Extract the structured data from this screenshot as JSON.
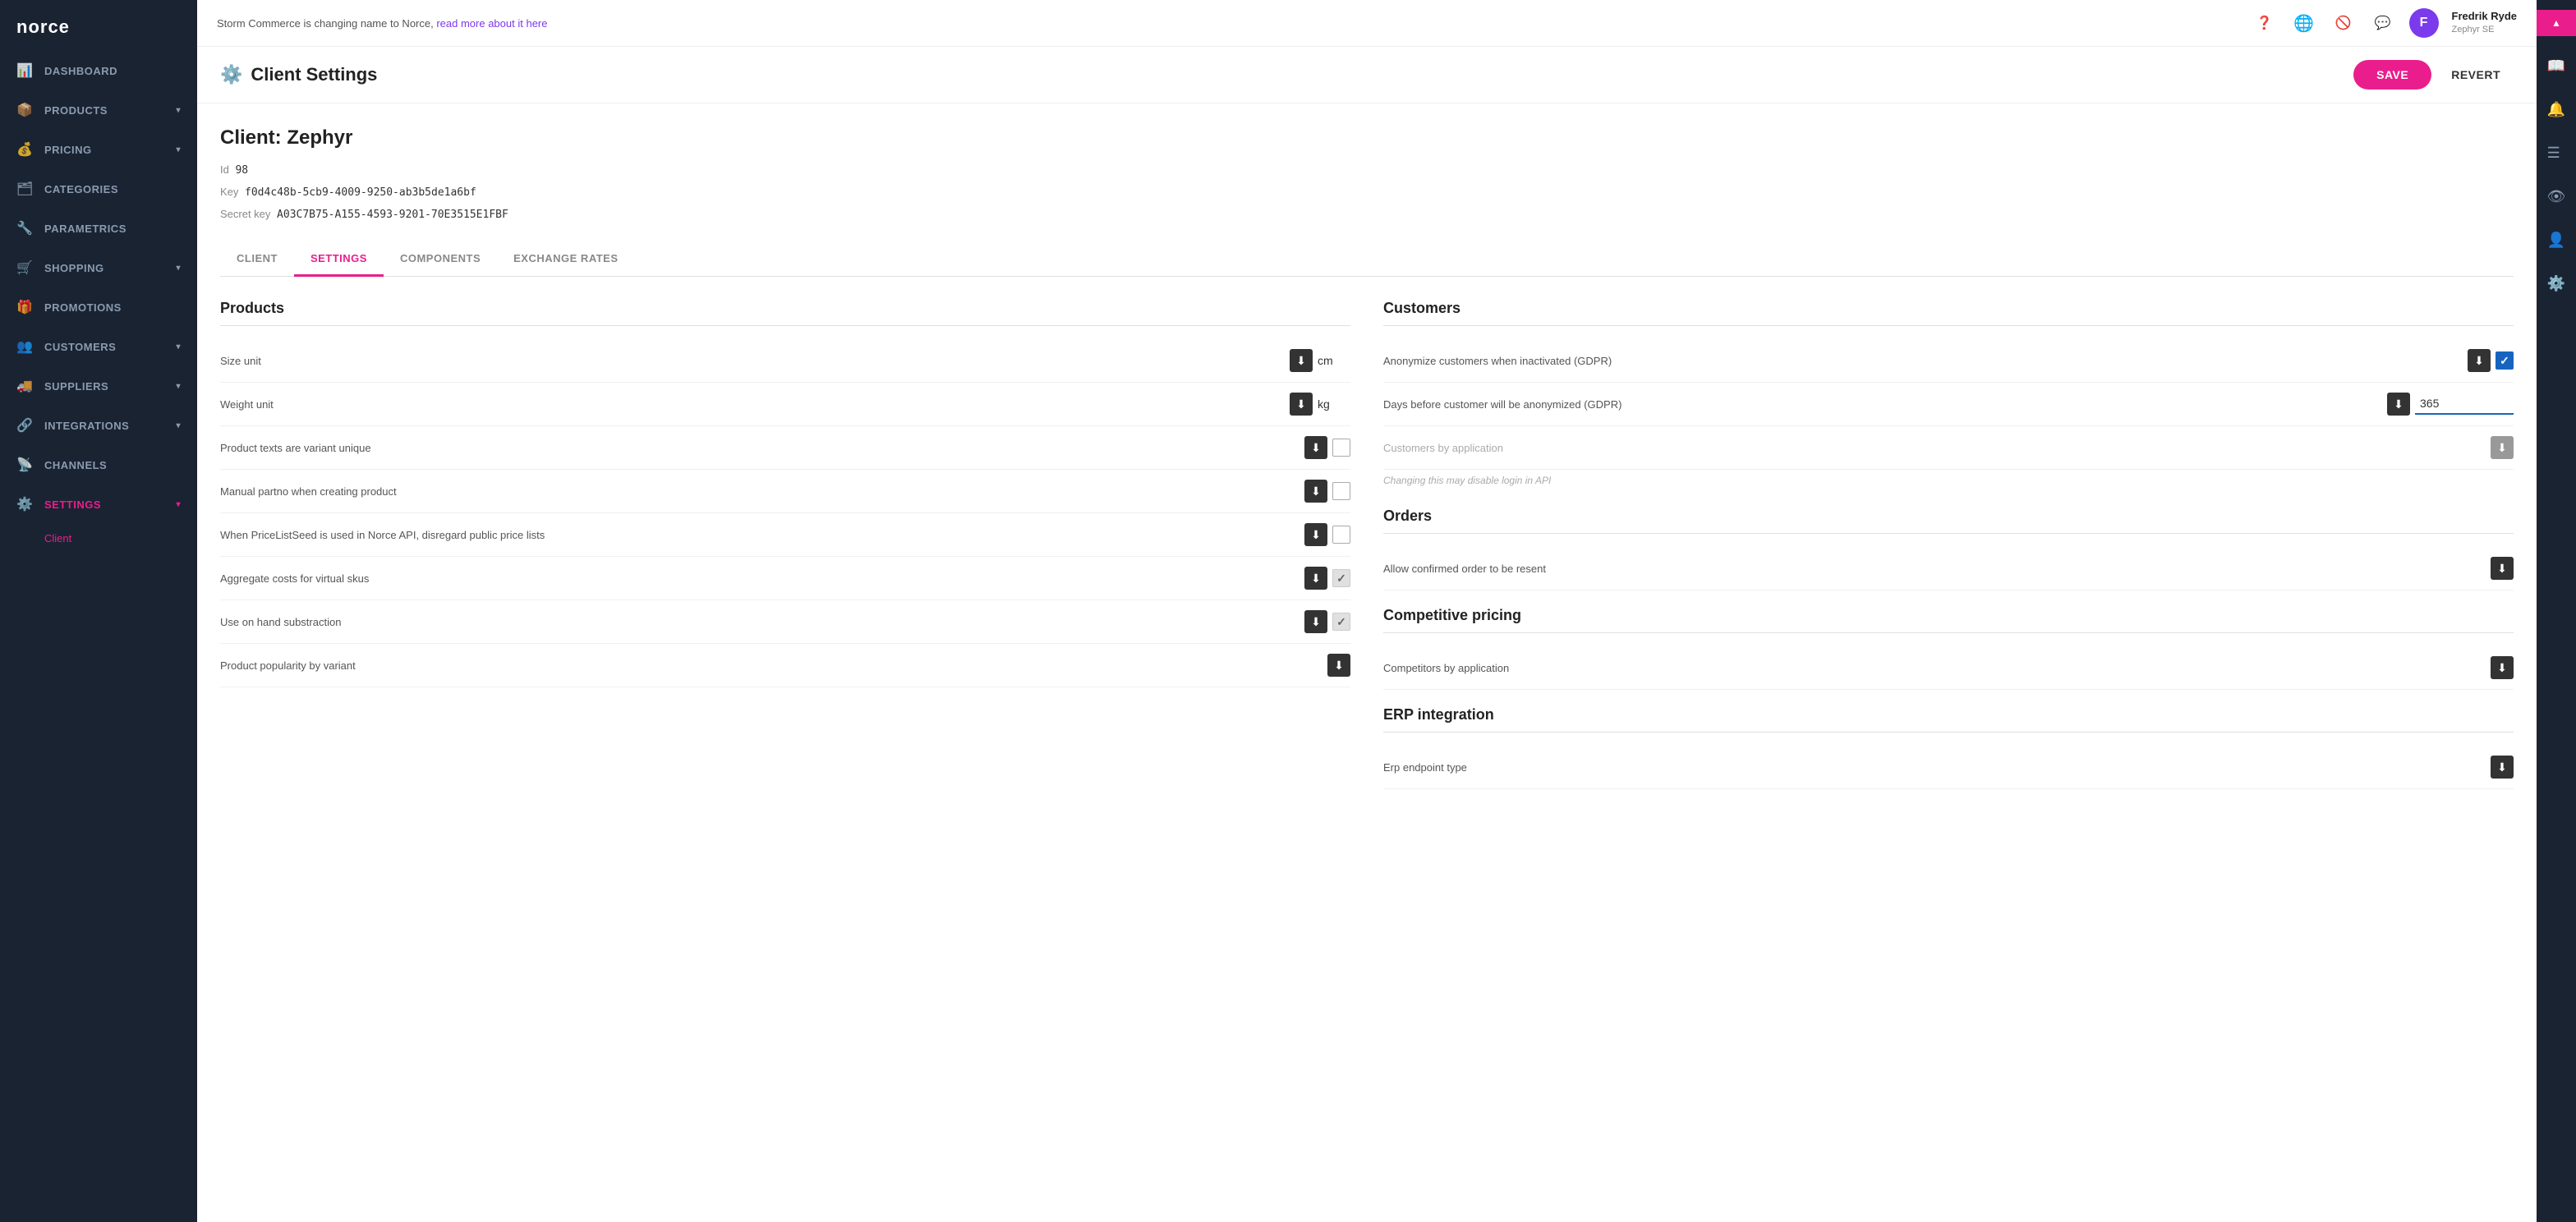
{
  "banner": {
    "text": "Storm Commerce is changing name to Norce,",
    "link_text": "read more about it here",
    "link_url": "#"
  },
  "user": {
    "name": "Fredrik Ryde",
    "subtitle": "Zephyr SE",
    "avatar_initials": "F"
  },
  "sidebar": {
    "logo": "norce",
    "items": [
      {
        "id": "dashboard",
        "label": "DASHBOARD",
        "icon": "📊",
        "has_chevron": false
      },
      {
        "id": "products",
        "label": "PRODUCTS",
        "icon": "📦",
        "has_chevron": true
      },
      {
        "id": "pricing",
        "label": "PRICING",
        "icon": "💰",
        "has_chevron": true
      },
      {
        "id": "categories",
        "label": "CATEGORIES",
        "icon": "🗂",
        "has_chevron": false
      },
      {
        "id": "parametrics",
        "label": "PARAMETRICS",
        "icon": "🔧",
        "has_chevron": false
      },
      {
        "id": "shopping",
        "label": "SHOPPING",
        "icon": "🛒",
        "has_chevron": true
      },
      {
        "id": "promotions",
        "label": "PROMOTIONS",
        "icon": "🎁",
        "has_chevron": false
      },
      {
        "id": "customers",
        "label": "CUSTOMERS",
        "icon": "👥",
        "has_chevron": true
      },
      {
        "id": "suppliers",
        "label": "SUPPLIERS",
        "icon": "🚚",
        "has_chevron": true
      },
      {
        "id": "integrations",
        "label": "INTEGRATIONS",
        "icon": "🔗",
        "has_chevron": true
      },
      {
        "id": "channels",
        "label": "CHANNELS",
        "icon": "📡",
        "has_chevron": false
      },
      {
        "id": "settings",
        "label": "SETTINGS",
        "icon": "⚙️",
        "has_chevron": true,
        "active": true
      }
    ],
    "sub_items": [
      {
        "label": "Client"
      }
    ]
  },
  "page": {
    "title": "Client Settings",
    "save_label": "SAVE",
    "revert_label": "REVERT"
  },
  "client": {
    "title": "Client: Zephyr",
    "id_label": "Id",
    "id_value": "98",
    "key_label": "Key",
    "key_value": "f0d4c48b-5cb9-4009-9250-ab3b5de1a6bf",
    "secret_label": "Secret key",
    "secret_value": "A03C7B75-A155-4593-9201-70E3515E1FBF"
  },
  "tabs": [
    {
      "id": "client",
      "label": "CLIENT"
    },
    {
      "id": "settings",
      "label": "SETTINGS",
      "active": true
    },
    {
      "id": "components",
      "label": "COMPONENTS"
    },
    {
      "id": "exchange_rates",
      "label": "EXCHANGE RATES"
    }
  ],
  "products_section": {
    "title": "Products",
    "rows": [
      {
        "label": "Size unit",
        "control_type": "arrow_text",
        "value": "cm"
      },
      {
        "label": "Weight unit",
        "control_type": "arrow_text",
        "value": "kg"
      },
      {
        "label": "Product texts are variant unique",
        "control_type": "arrow_checkbox",
        "checked": false
      },
      {
        "label": "Manual partno when creating product",
        "control_type": "arrow_checkbox",
        "checked": false
      },
      {
        "label": "When PriceListSeed is used in Norce API, disregard public price lists",
        "control_type": "arrow_checkbox",
        "checked": false
      },
      {
        "label": "Aggregate costs for virtual skus",
        "control_type": "arrow_checkbox_light",
        "checked": true
      },
      {
        "label": "Use on hand substraction",
        "control_type": "arrow_checkbox_light",
        "checked": true
      },
      {
        "label": "Product popularity by variant",
        "control_type": "arrow_only"
      }
    ]
  },
  "customers_section": {
    "title": "Customers",
    "rows": [
      {
        "label": "Anonymize customers when inactivated (GDPR)",
        "control_type": "arrow_checkbox_checked",
        "checked": true
      },
      {
        "label": "Days before customer will be anonymized (GDPR)",
        "control_type": "arrow_input",
        "value": "365"
      },
      {
        "label": "Customers by application",
        "control_type": "arrow_disabled",
        "note": "Changing this may disable login in API",
        "disabled": true
      }
    ]
  },
  "orders_section": {
    "title": "Orders",
    "rows": [
      {
        "label": "Allow confirmed order to be resent",
        "control_type": "arrow_only"
      }
    ]
  },
  "competitive_pricing_section": {
    "title": "Competitive pricing",
    "rows": [
      {
        "label": "Competitors by application",
        "control_type": "arrow_only"
      }
    ]
  },
  "erp_section": {
    "title": "ERP integration",
    "rows": [
      {
        "label": "Erp endpoint type",
        "control_type": "arrow_only"
      }
    ]
  }
}
